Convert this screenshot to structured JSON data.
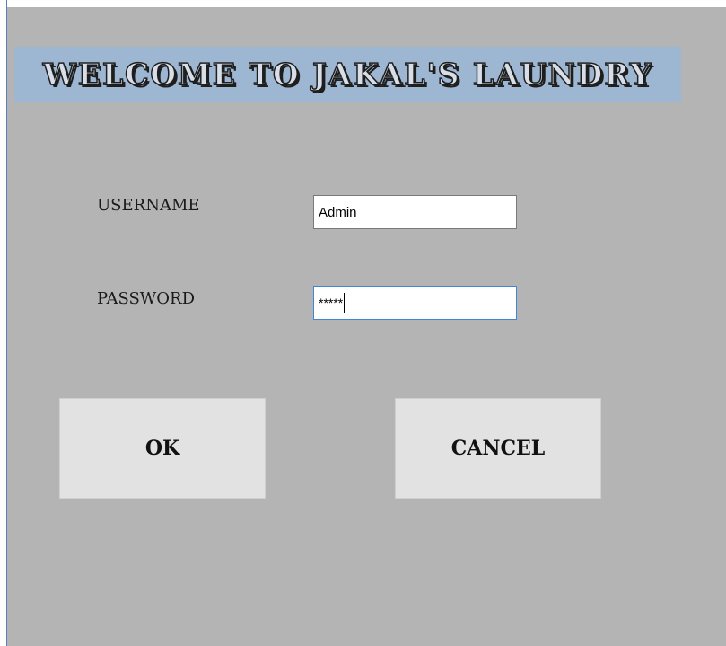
{
  "banner": {
    "title": "WELCOME TO JAKAL'S LAUNDRY"
  },
  "form": {
    "username_label": "USERNAME",
    "username_value": "Admin",
    "password_label": "PASSWORD",
    "password_mask": "*****"
  },
  "buttons": {
    "ok_label": "OK",
    "cancel_label": "CANCEL"
  },
  "colors": {
    "background": "#b4b4b4",
    "banner": "#9db6d2",
    "button": "#e2e2e2",
    "focus_border": "#3f86d6"
  }
}
